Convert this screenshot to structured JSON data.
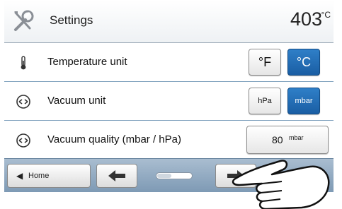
{
  "header": {
    "title": "Settings",
    "temperature": "403",
    "temperature_unit": "°C"
  },
  "rows": [
    {
      "label": "Temperature unit",
      "options": [
        "°F",
        "°C"
      ],
      "selected": "°C",
      "icon": "thermometer-icon"
    },
    {
      "label": "Vacuum unit",
      "options": [
        "hPa",
        "mbar"
      ],
      "selected": "mbar",
      "icon": "vacuum-gauge-icon"
    },
    {
      "label": "Vacuum quality (mbar / hPa)",
      "value": "80",
      "unit": "mbar",
      "icon": "vacuum-gauge-icon"
    }
  ],
  "footer": {
    "home_label": "Home",
    "page_position": 0.4
  },
  "colors": {
    "accent": "#1e66b0",
    "background": "#7fa1bd"
  }
}
